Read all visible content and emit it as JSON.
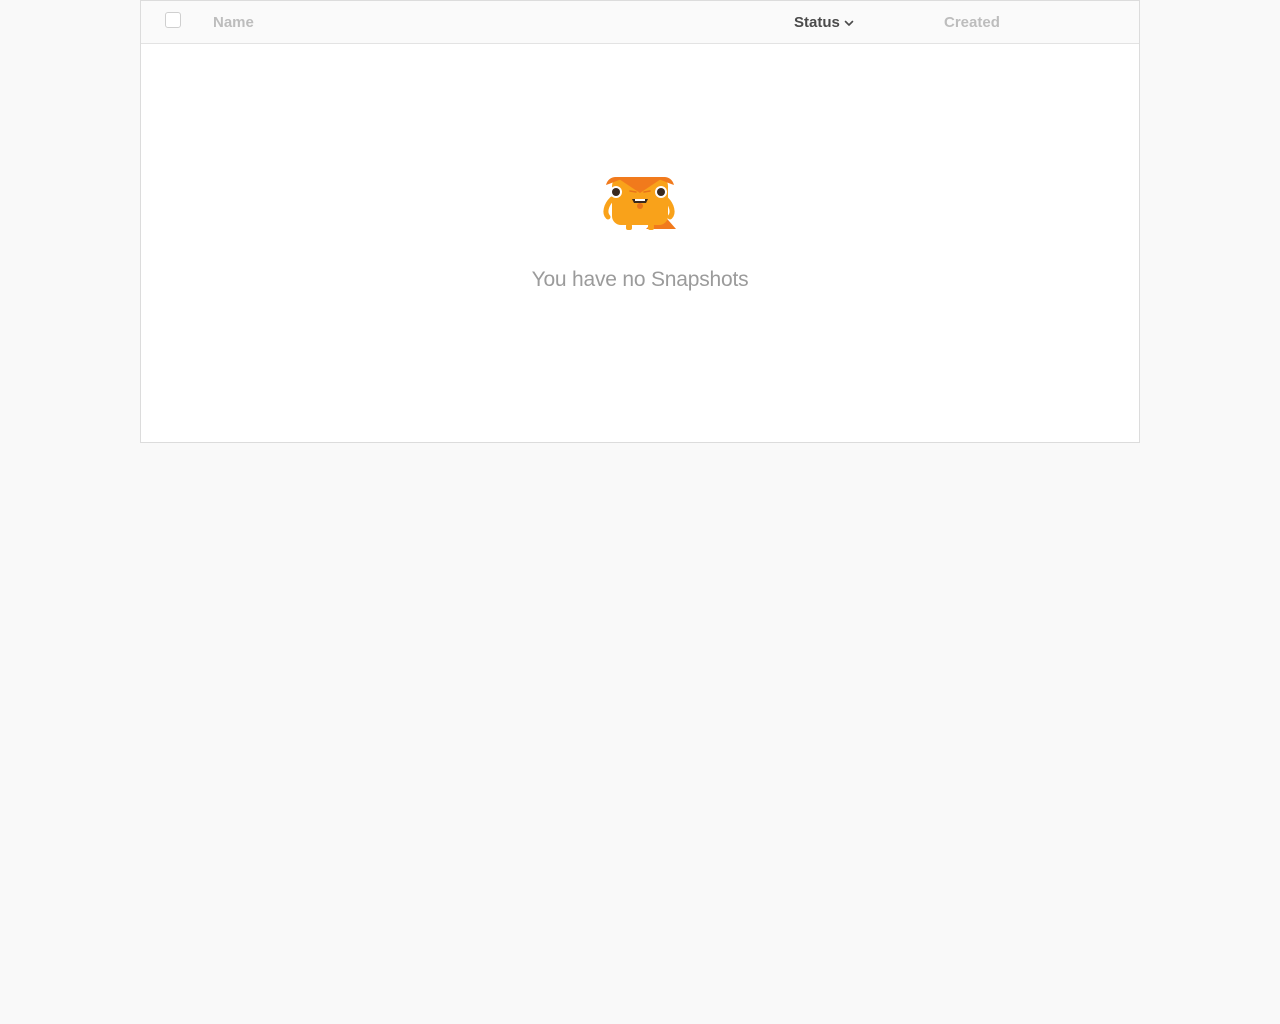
{
  "table": {
    "columns": {
      "name": "Name",
      "status": "Status",
      "created": "Created"
    },
    "sorted_by": "Status",
    "sort_direction": "descending",
    "empty_message": "You have no Snapshots"
  },
  "icons": {
    "sort": "chevron-down-icon",
    "empty_state": "sammy-mascot-icon"
  },
  "colors": {
    "page_bg": "#f9f9f9",
    "header_bg": "#fafafa",
    "active_header_text": "#4b4b4b",
    "inactive_header_text": "#bdbdbd",
    "empty_text": "#9b9b9b",
    "mascot_orange": "#f9a21a",
    "mascot_dark_orange": "#f17a1c"
  }
}
